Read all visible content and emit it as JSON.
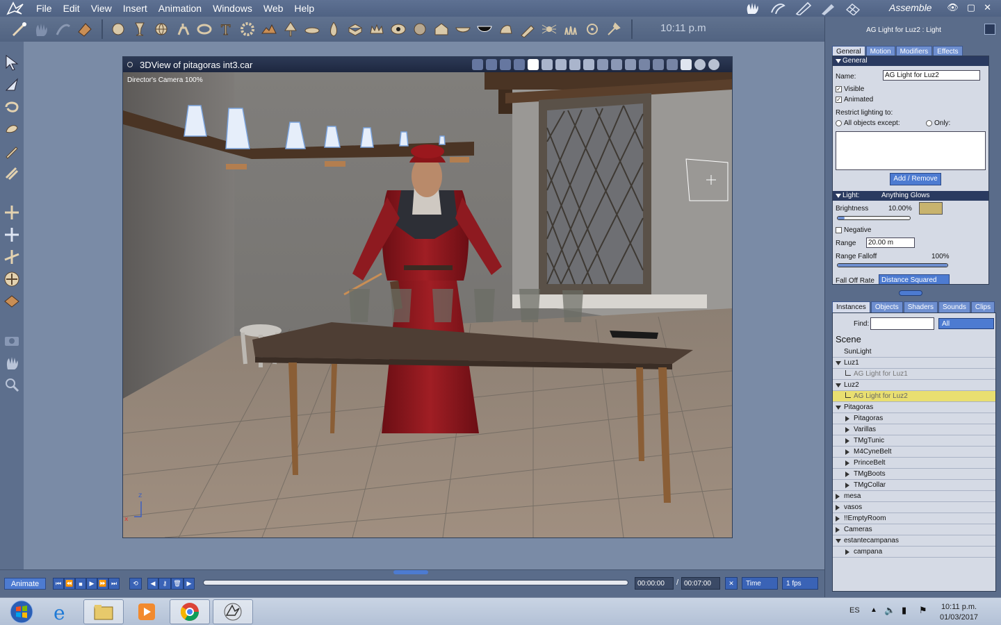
{
  "menubar": {
    "items": [
      "File",
      "Edit",
      "View",
      "Insert",
      "Animation",
      "Windows",
      "Web",
      "Help"
    ],
    "mode_label": "Assemble"
  },
  "toolbar": {
    "clock": "10:11 p.m"
  },
  "view3d": {
    "title": "3DView of pitagoras  int3.car",
    "camera_label": "Director's Camera 100%"
  },
  "timeline": {
    "animate_label": "Animate",
    "current_time": "00:00:00",
    "separator": "/",
    "end_time": "00:07:00",
    "time_mode": "Time",
    "fps": "1 fps"
  },
  "properties": {
    "title": "AG Light for Luz2 : Light",
    "tabs": [
      "General",
      "Motion",
      "Modifiers",
      "Effects"
    ],
    "general_header": "General",
    "name_label": "Name:",
    "name_value": "AG Light for Luz2",
    "visible_label": "Visible",
    "animated_label": "Animated",
    "restrict_label": "Restrict lighting to:",
    "all_except_label": "All objects except:",
    "only_label": "Only:",
    "add_remove_label": "Add / Remove",
    "light_header": "Light:",
    "light_type": "Anything Glows",
    "brightness_label": "Brightness",
    "brightness_value": "10.00%",
    "brightness_color": "#c8b36e",
    "brightness_level": 0.1,
    "negative_label": "Negative",
    "range_label": "Range",
    "range_value": "20.00 m",
    "range_falloff_label": "Range Falloff",
    "range_falloff_value": "100%",
    "range_falloff_level": 1.0,
    "falloff_rate_label": "Fall Off Rate",
    "falloff_rate_value": "Distance Squared"
  },
  "instances": {
    "tabs": [
      "Instances",
      "Objects",
      "Shaders",
      "Sounds",
      "Clips"
    ],
    "find_label": "Find:",
    "find_value": "",
    "filter_value": "All",
    "scene_title": "Scene",
    "tree": [
      {
        "label": "SunLight",
        "level": 0,
        "toggle": "none",
        "state": "normal"
      },
      {
        "label": "Luz1",
        "level": 0,
        "toggle": "open",
        "state": "normal"
      },
      {
        "label": "AG Light for Luz1",
        "level": 1,
        "toggle": "leaf",
        "state": "dim"
      },
      {
        "label": "Luz2",
        "level": 0,
        "toggle": "open",
        "state": "normal"
      },
      {
        "label": "AG Light for Luz2",
        "level": 1,
        "toggle": "leaf",
        "state": "selected"
      },
      {
        "label": "Pitagoras",
        "level": 0,
        "toggle": "open",
        "state": "normal"
      },
      {
        "label": "Pitagoras",
        "level": 1,
        "toggle": "closed",
        "state": "normal"
      },
      {
        "label": "Varillas",
        "level": 1,
        "toggle": "closed",
        "state": "normal"
      },
      {
        "label": "TMgTunic",
        "level": 1,
        "toggle": "closed",
        "state": "normal"
      },
      {
        "label": "M4CyneBelt",
        "level": 1,
        "toggle": "closed",
        "state": "normal"
      },
      {
        "label": "PrinceBelt",
        "level": 1,
        "toggle": "closed",
        "state": "normal"
      },
      {
        "label": "TMgBoots",
        "level": 1,
        "toggle": "closed",
        "state": "normal"
      },
      {
        "label": "TMgCollar",
        "level": 1,
        "toggle": "closed",
        "state": "normal"
      },
      {
        "label": "mesa",
        "level": 0,
        "toggle": "closed",
        "state": "normal"
      },
      {
        "label": "vasos",
        "level": 0,
        "toggle": "closed",
        "state": "normal"
      },
      {
        "label": "!!EmptyRoom",
        "level": 0,
        "toggle": "closed",
        "state": "normal"
      },
      {
        "label": "Cameras",
        "level": 0,
        "toggle": "closed",
        "state": "normal"
      },
      {
        "label": "estantecampanas",
        "level": 0,
        "toggle": "open",
        "state": "normal"
      },
      {
        "label": "campana",
        "level": 1,
        "toggle": "closed",
        "state": "normal"
      }
    ]
  },
  "taskbar": {
    "language": "ES",
    "time": "10:11 p.m.",
    "date": "01/03/2017"
  }
}
